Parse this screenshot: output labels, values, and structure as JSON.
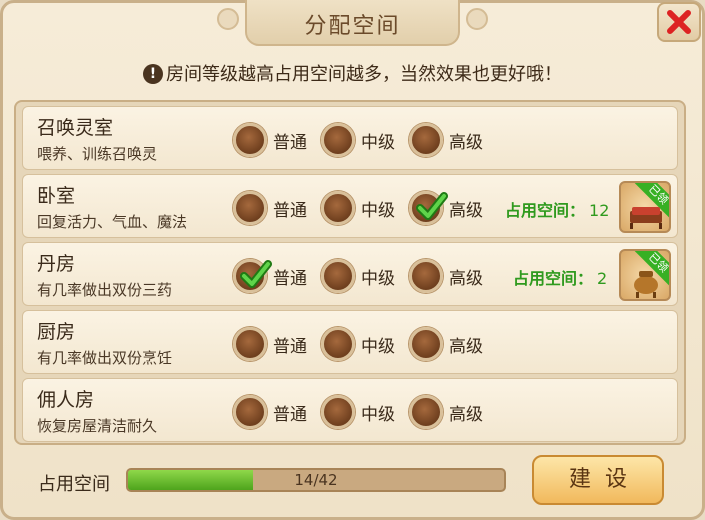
{
  "title": "分配空间",
  "notice": "房间等级越高占用空间越多，当然效果也更好哦！",
  "levels": [
    "普通",
    "中级",
    "高级"
  ],
  "rooms": [
    {
      "name": "召唤灵室",
      "desc": "喂养、训练召唤灵",
      "selected": null,
      "usage_label": "",
      "usage_value": "",
      "owned_badge": ""
    },
    {
      "name": "卧室",
      "desc": "回复活力、气血、魔法",
      "selected": 2,
      "usage_label": "占用空间：",
      "usage_value": "12",
      "owned_badge": "已领"
    },
    {
      "name": "丹房",
      "desc": "有几率做出双份三药",
      "selected": 0,
      "usage_label": "占用空间：",
      "usage_value": "2",
      "owned_badge": "已领"
    },
    {
      "name": "厨房",
      "desc": "有几率做出双份烹饪",
      "selected": null,
      "usage_label": "",
      "usage_value": "",
      "owned_badge": ""
    },
    {
      "name": "佣人房",
      "desc": "恢复房屋清洁耐久",
      "selected": null,
      "usage_label": "",
      "usage_value": "",
      "owned_badge": ""
    }
  ],
  "footer": {
    "space_label": "占用空间",
    "progress_text": "14/42",
    "progress_fraction": 0.333,
    "build_label": "建设"
  },
  "colors": {
    "usage_green": "#2f9a1e",
    "check_green": "#3bb52a",
    "progress_green": "#6cc234"
  },
  "icons": {
    "close": "close-x-icon",
    "notice": "exclamation-icon",
    "bed": "bed-icon",
    "furnace": "alchemy-furnace-icon"
  }
}
